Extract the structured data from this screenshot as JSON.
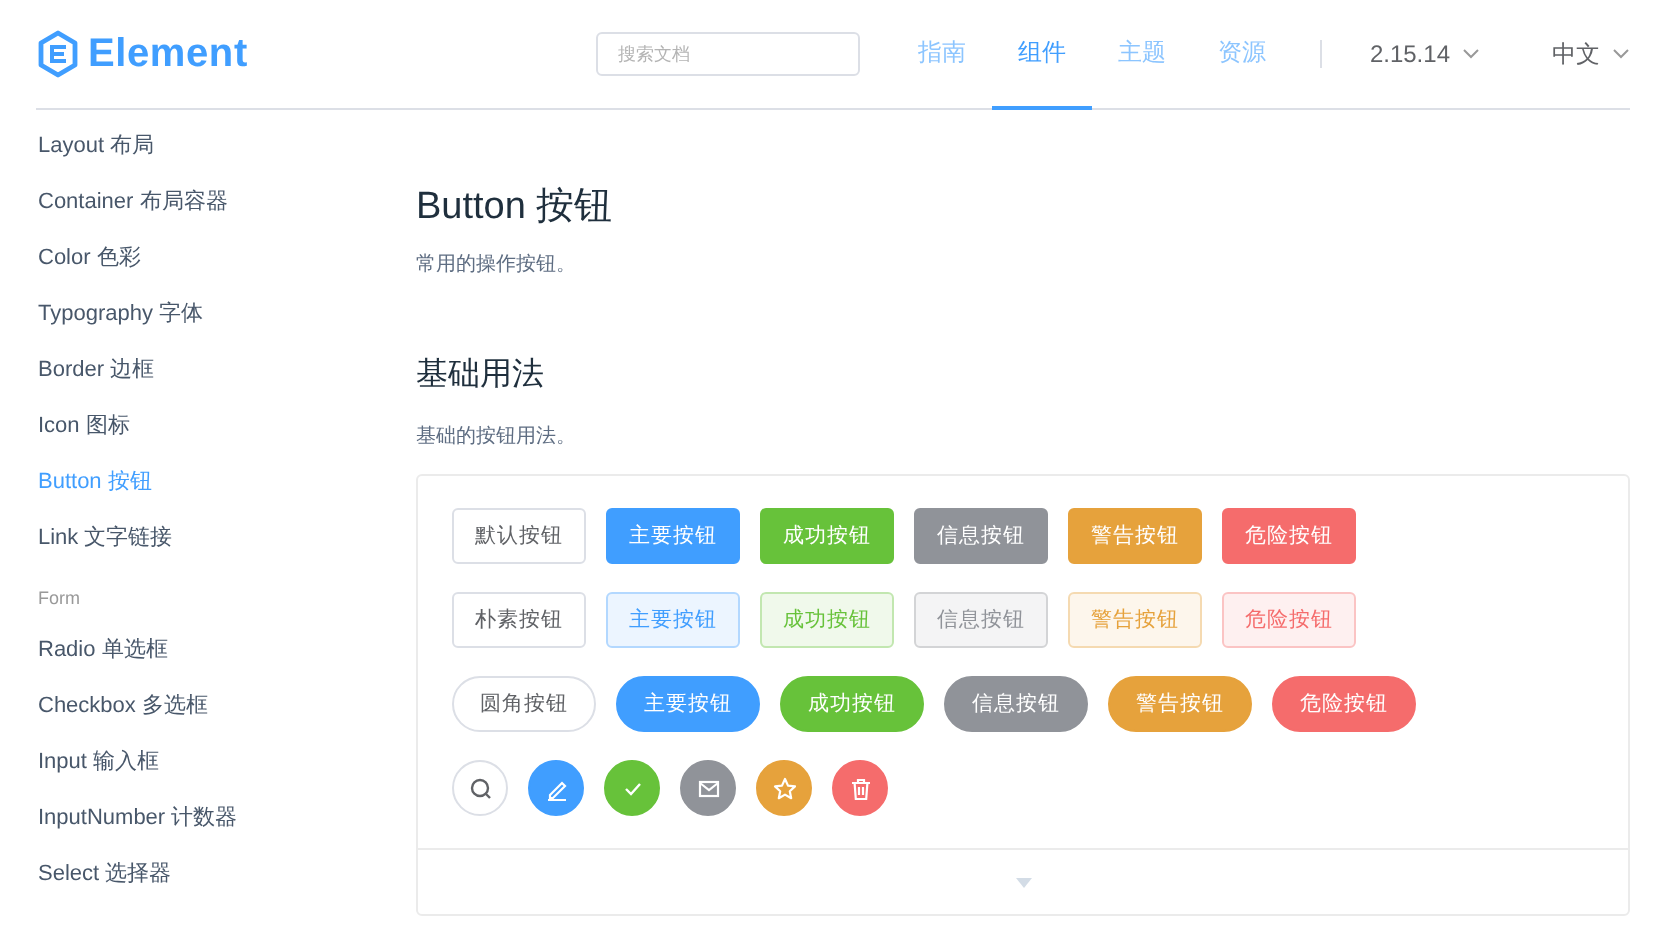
{
  "header": {
    "logo_text": "Element",
    "search": {
      "placeholder": "搜索文档"
    },
    "nav": [
      {
        "label": "指南",
        "selected": false
      },
      {
        "label": "组件",
        "selected": true
      },
      {
        "label": "主题",
        "selected": false
      },
      {
        "label": "资源",
        "selected": false
      }
    ],
    "version": "2.15.14",
    "language": "中文"
  },
  "sidebar": {
    "items": [
      {
        "kind": "item",
        "label": "Layout 布局",
        "selected": false
      },
      {
        "kind": "item",
        "label": "Container 布局容器",
        "selected": false
      },
      {
        "kind": "item",
        "label": "Color 色彩",
        "selected": false
      },
      {
        "kind": "item",
        "label": "Typography 字体",
        "selected": false
      },
      {
        "kind": "item",
        "label": "Border 边框",
        "selected": false
      },
      {
        "kind": "item",
        "label": "Icon 图标",
        "selected": false
      },
      {
        "kind": "item",
        "label": "Button 按钮",
        "selected": true
      },
      {
        "kind": "item",
        "label": "Link 文字链接",
        "selected": false
      },
      {
        "kind": "group",
        "label": "Form"
      },
      {
        "kind": "item",
        "label": "Radio 单选框",
        "selected": false
      },
      {
        "kind": "item",
        "label": "Checkbox 多选框",
        "selected": false
      },
      {
        "kind": "item",
        "label": "Input 输入框",
        "selected": false
      },
      {
        "kind": "item",
        "label": "InputNumber 计数器",
        "selected": false
      },
      {
        "kind": "item",
        "label": "Select 选择器",
        "selected": false
      }
    ]
  },
  "page": {
    "title": "Button 按钮",
    "description": "常用的操作按钮。",
    "section_title": "基础用法",
    "section_description": "基础的按钮用法。",
    "demo_rows": [
      {
        "kind": "default",
        "buttons": [
          {
            "label": "默认按钮",
            "kind": "default"
          },
          {
            "label": "主要按钮",
            "kind": "primary"
          },
          {
            "label": "成功按钮",
            "kind": "success"
          },
          {
            "label": "信息按钮",
            "kind": "info"
          },
          {
            "label": "警告按钮",
            "kind": "warning"
          },
          {
            "label": "危险按钮",
            "kind": "danger"
          }
        ]
      },
      {
        "kind": "plain",
        "buttons": [
          {
            "label": "朴素按钮",
            "kind": "default"
          },
          {
            "label": "主要按钮",
            "kind": "primary"
          },
          {
            "label": "成功按钮",
            "kind": "success"
          },
          {
            "label": "信息按钮",
            "kind": "info"
          },
          {
            "label": "警告按钮",
            "kind": "warning"
          },
          {
            "label": "危险按钮",
            "kind": "danger"
          }
        ]
      },
      {
        "kind": "round",
        "buttons": [
          {
            "label": "圆角按钮",
            "kind": "default"
          },
          {
            "label": "主要按钮",
            "kind": "primary"
          },
          {
            "label": "成功按钮",
            "kind": "success"
          },
          {
            "label": "信息按钮",
            "kind": "info"
          },
          {
            "label": "警告按钮",
            "kind": "warning"
          },
          {
            "label": "危险按钮",
            "kind": "danger"
          }
        ]
      },
      {
        "kind": "circle",
        "buttons": [
          {
            "kind": "default"
          },
          {
            "kind": "primary"
          },
          {
            "kind": "success"
          },
          {
            "kind": "info"
          },
          {
            "kind": "warning"
          },
          {
            "kind": "danger"
          }
        ]
      }
    ]
  }
}
